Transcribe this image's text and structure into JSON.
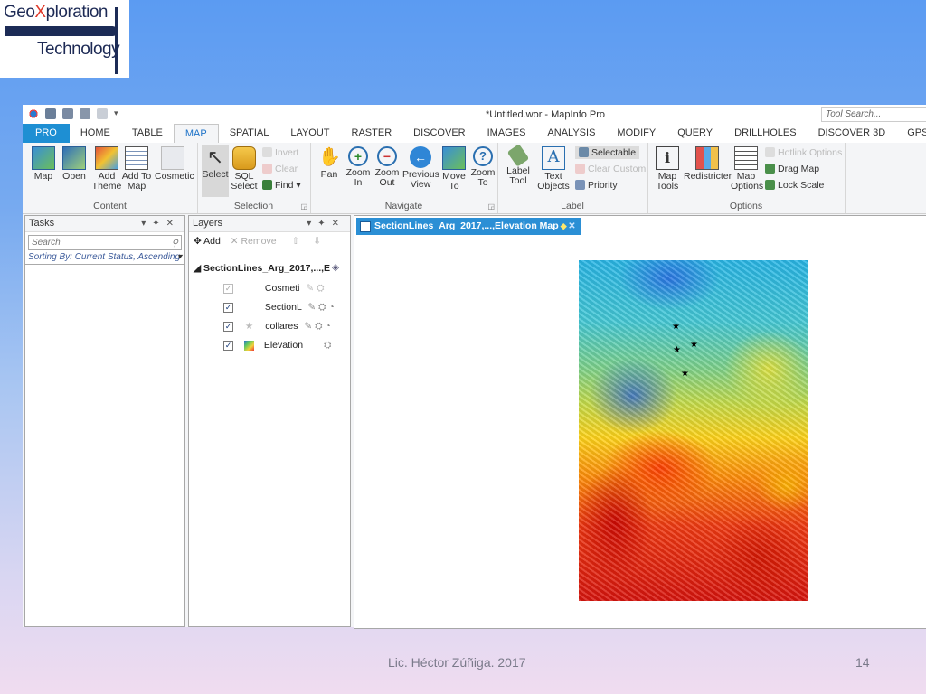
{
  "logo": {
    "line1_pre": "Geo",
    "line1_x": "X",
    "line1_post": "ploration",
    "line2": "Technology"
  },
  "app": {
    "title": "*Untitled.wor - MapInfo Pro",
    "tool_search_placeholder": "Tool Search..."
  },
  "tabs": [
    {
      "label": "PRO"
    },
    {
      "label": "HOME"
    },
    {
      "label": "TABLE"
    },
    {
      "label": "MAP"
    },
    {
      "label": "SPATIAL"
    },
    {
      "label": "LAYOUT"
    },
    {
      "label": "RASTER"
    },
    {
      "label": "DISCOVER"
    },
    {
      "label": "IMAGES"
    },
    {
      "label": "ANALYSIS"
    },
    {
      "label": "MODIFY"
    },
    {
      "label": "QUERY"
    },
    {
      "label": "DRILLHOLES"
    },
    {
      "label": "DISCOVER 3D"
    },
    {
      "label": "GPS"
    }
  ],
  "active_tab": "MAP",
  "ribbon": {
    "content": {
      "label": "Content",
      "map": "Map",
      "open": "Open",
      "add_theme_1": "Add",
      "add_theme_2": "Theme",
      "add_to_map_1": "Add To",
      "add_to_map_2": "Map",
      "cosmetic": "Cosmetic"
    },
    "selection": {
      "label": "Selection",
      "select": "Select",
      "sql_1": "SQL",
      "sql_2": "Select",
      "invert": "Invert",
      "clear": "Clear",
      "find": "Find"
    },
    "navigate": {
      "label": "Navigate",
      "pan": "Pan",
      "zoom_in_1": "Zoom",
      "zoom_in_2": "In",
      "zoom_out_1": "Zoom",
      "zoom_out_2": "Out",
      "prev_1": "Previous",
      "prev_2": "View",
      "move_1": "Move",
      "move_2": "To",
      "zoomto_1": "Zoom",
      "zoomto_2": "To"
    },
    "label_group": {
      "label": "Label",
      "label_tool_1": "Label",
      "label_tool_2": "Tool",
      "text_obj_1": "Text",
      "text_obj_2": "Objects",
      "selectable": "Selectable",
      "clear_custom": "Clear Custom",
      "priority": "Priority"
    },
    "options": {
      "label": "Options",
      "map_tools_1": "Map",
      "map_tools_2": "Tools",
      "redistricter": "Redistricter",
      "map_options_1": "Map",
      "map_options_2": "Options",
      "hotlink": "Hotlink Options",
      "drag_map": "Drag Map",
      "lock_scale": "Lock Scale"
    }
  },
  "tasks": {
    "title": "Tasks",
    "search_placeholder": "Search",
    "sort": "Sorting By: Current Status, Ascending"
  },
  "layers": {
    "title": "Layers",
    "add": "Add",
    "remove": "Remove",
    "map_name": "SectionLines_Arg_2017,...,E",
    "items": [
      {
        "name": "Cosmeti",
        "checked": true
      },
      {
        "name": "SectionL",
        "checked": true
      },
      {
        "name": "collares",
        "checked": true
      },
      {
        "name": "Elevation",
        "checked": true
      }
    ]
  },
  "map_window": {
    "tab_title": "SectionLines_Arg_2017,...,Elevation Map"
  },
  "footer": {
    "author": "Lic. Héctor Zúñiga. 2017",
    "page": "14"
  }
}
